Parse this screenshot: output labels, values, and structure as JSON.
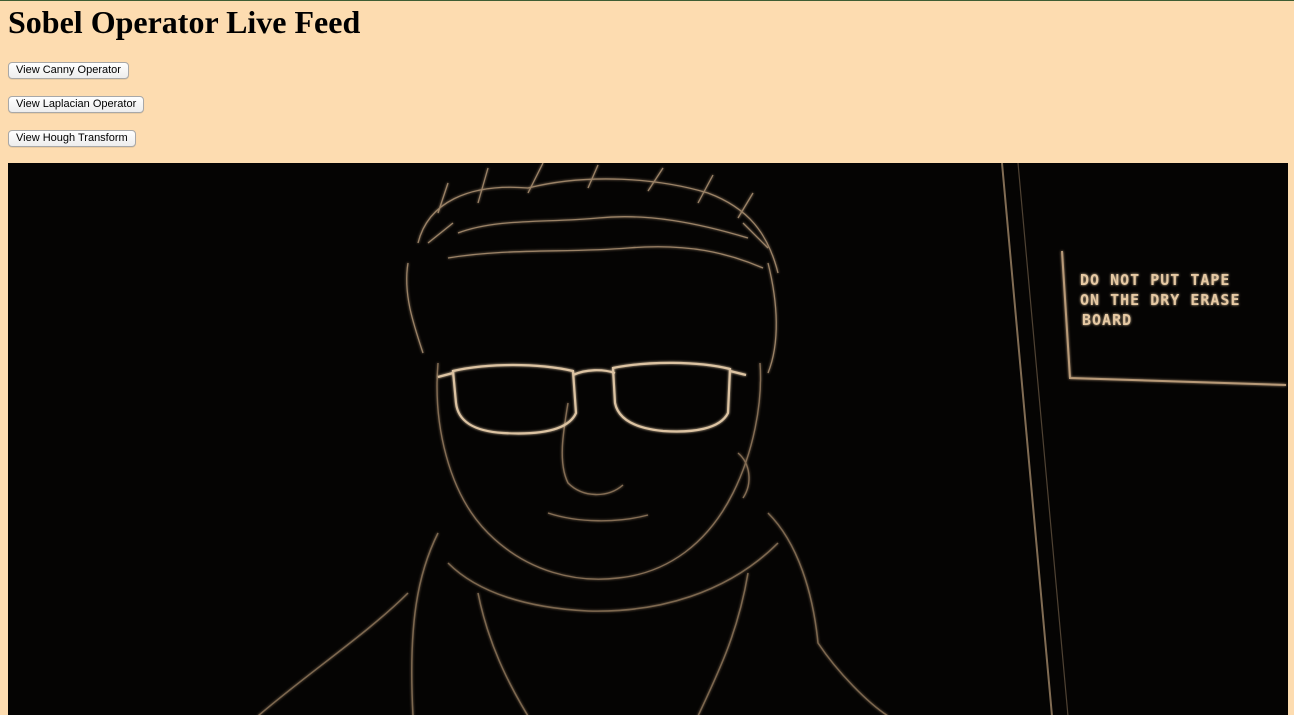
{
  "page": {
    "title": "Sobel Operator Live Feed"
  },
  "buttons": {
    "canny": "View Canny Operator",
    "laplacian": "View Laplacian Operator",
    "hough": "View Hough Transform"
  },
  "feed": {
    "sign_lines": [
      "DO NOT PUT TAPE",
      "ON THE DRY ERASE",
      "BOARD"
    ]
  },
  "colors": {
    "page_background": "#fddcb0",
    "feed_background": "#050403",
    "edge_highlight": "#d9bc97"
  }
}
